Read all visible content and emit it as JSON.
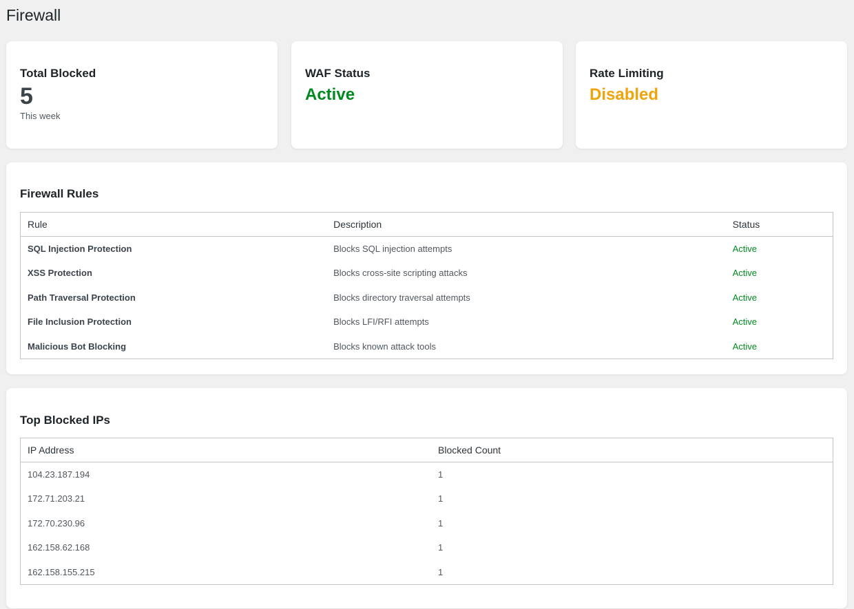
{
  "page": {
    "title": "Firewall"
  },
  "stats": [
    {
      "label": "Total Blocked",
      "value": "5",
      "sub": "This week"
    },
    {
      "label": "WAF Status",
      "value": "Active",
      "color": "#008a20"
    },
    {
      "label": "Rate Limiting",
      "value": "Disabled",
      "color": "#f0a30a"
    }
  ],
  "rules": {
    "title": "Firewall Rules",
    "headers": {
      "rule": "Rule",
      "description": "Description",
      "status": "Status"
    },
    "rows": [
      {
        "rule": "SQL Injection Protection",
        "description": "Blocks SQL injection attempts",
        "status": "Active"
      },
      {
        "rule": "XSS Protection",
        "description": "Blocks cross-site scripting attacks",
        "status": "Active"
      },
      {
        "rule": "Path Traversal Protection",
        "description": "Blocks directory traversal attempts",
        "status": "Active"
      },
      {
        "rule": "File Inclusion Protection",
        "description": "Blocks LFI/RFI attempts",
        "status": "Active"
      },
      {
        "rule": "Malicious Bot Blocking",
        "description": "Blocks known attack tools",
        "status": "Active"
      }
    ]
  },
  "blocked_ips": {
    "title": "Top Blocked IPs",
    "headers": {
      "ip": "IP Address",
      "count": "Blocked Count"
    },
    "rows": [
      {
        "ip": "104.23.187.194",
        "count": "1"
      },
      {
        "ip": "172.71.203.21",
        "count": "1"
      },
      {
        "ip": "172.70.230.96",
        "count": "1"
      },
      {
        "ip": "162.158.62.168",
        "count": "1"
      },
      {
        "ip": "162.158.155.215",
        "count": "1"
      }
    ]
  },
  "colors": {
    "active": "#008a20",
    "disabled": "#f0a30a"
  }
}
